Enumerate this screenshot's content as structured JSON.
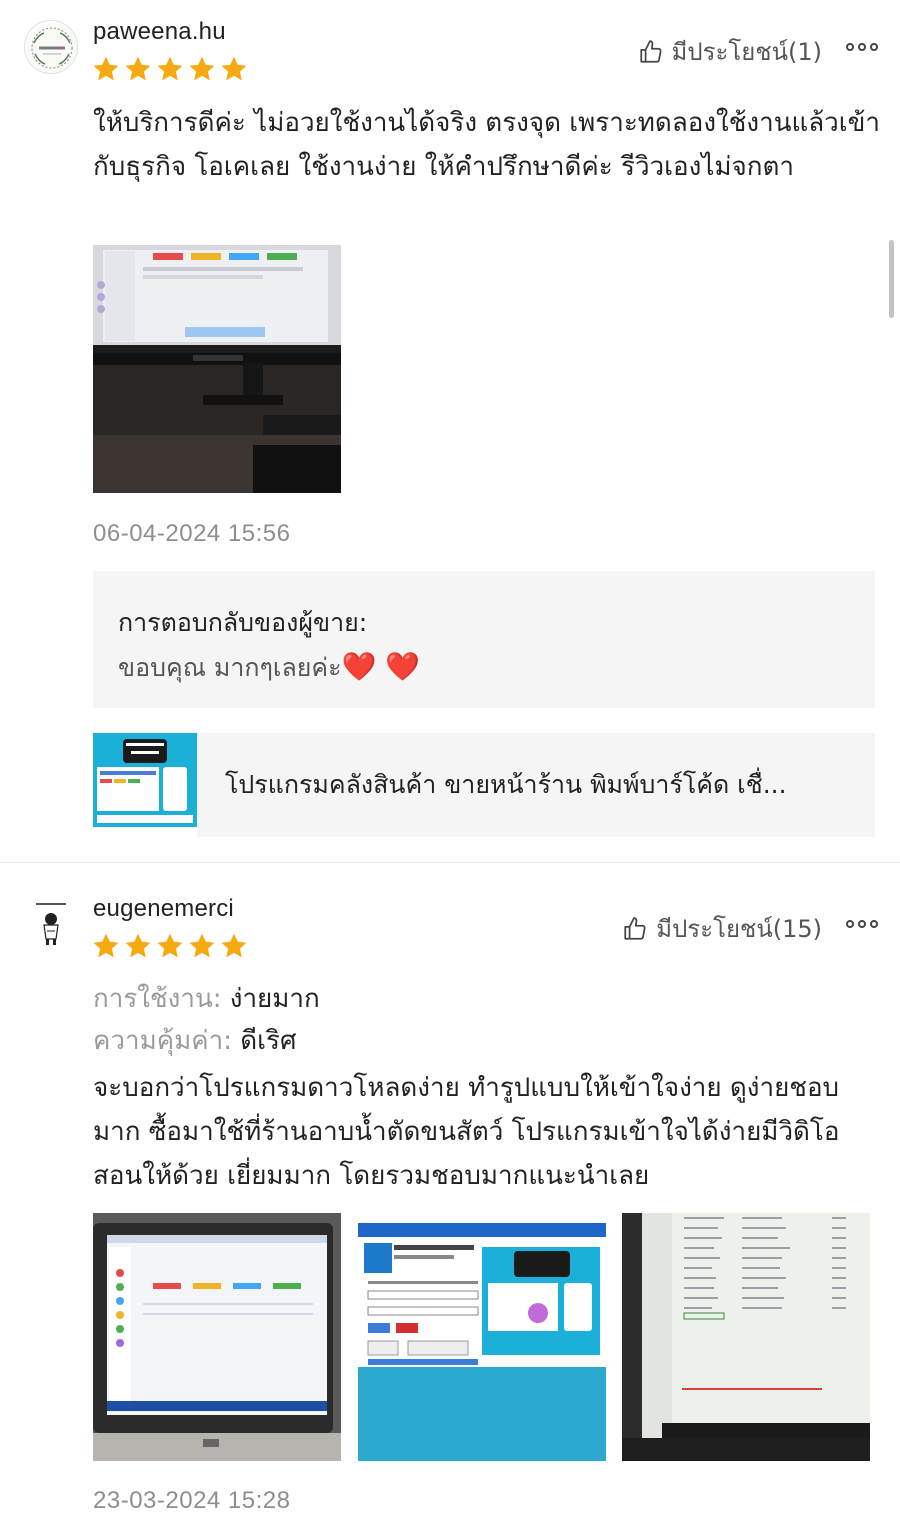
{
  "reviews": [
    {
      "username": "paweena.hu",
      "rating": 5,
      "helpful_label": "มีประโยชน์(1)",
      "text": "ให้บริการดีค่ะ ไม่อวยใช้งานได้จริง ตรงจุด เพราะทดลองใช้งานแล้วเข้ากับธุรกิจ โอเคเลย ใช้งานง่าย  ให้คำปรึกษาดีค่ะ รีวิวเองไม่จกตา",
      "date": "06-04-2024 15:56",
      "seller_response": {
        "title": "การตอบกลับของผู้ขาย:",
        "text": "ขอบคุณ มากๆเลยค่ะ",
        "hearts": "❤️ ❤️"
      },
      "product": {
        "name": "โปรแกรมคลังสินค้า ขายหน้าร้าน พิมพ์บาร์โค้ด เชื่..."
      }
    },
    {
      "username": "eugenemerci",
      "rating": 5,
      "helpful_label": "มีประโยชน์(15)",
      "attributes": [
        {
          "key": "การใช้งาน:",
          "value": "ง่ายมาก"
        },
        {
          "key": "ความคุ้มค่า:",
          "value": "ดีเริศ"
        }
      ],
      "text": "จะบอกว่าโปรแกรมดาวโหลดง่าย ทำรูปแบบให้เข้าใจง่าย ดูง่ายชอบมาก ซื้อมาใช้ที่ร้านอาบน้ำตัดขนสัตว์ โปรแกรมเข้าใจได้ง่ายมีวิดิโอสอนให้ด้วย เยี่ยมมาก โดยรวมชอบมากแนะนำเลย",
      "date": "23-03-2024 15:28"
    }
  ],
  "colors": {
    "star": "#f7a912",
    "muted": "#8e8e8e",
    "panel": "#f5f5f5"
  }
}
